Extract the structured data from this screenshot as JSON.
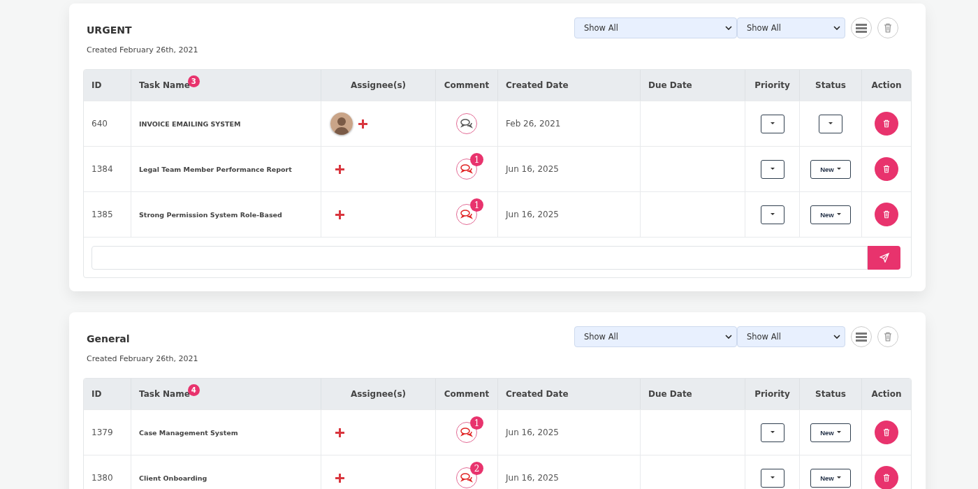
{
  "sections": [
    {
      "title": "URGENT",
      "created": "Created February 26th, 2021",
      "filters": [
        {
          "value": "Show All"
        },
        {
          "value": "Show All"
        }
      ],
      "task_count": "3",
      "columns": [
        "ID",
        "Task Name",
        "Assignee(s)",
        "Comment",
        "Created Date",
        "Due Date",
        "Priority",
        "Status",
        "Action"
      ],
      "rows": [
        {
          "id": "640",
          "task": "INVOICE EMAILING SYSTEM",
          "has_avatar": true,
          "comment_count": null,
          "created": "Feb 26, 2021",
          "status": null
        },
        {
          "id": "1384",
          "task": "Legal Team Member Performance Report",
          "has_avatar": false,
          "comment_count": "1",
          "created": "Jun 16, 2025",
          "status": "New"
        },
        {
          "id": "1385",
          "task": "Strong Permission System Role-Based",
          "has_avatar": false,
          "comment_count": "1",
          "created": "Jun 16, 2025",
          "status": "New"
        }
      ],
      "has_comment_box": true
    },
    {
      "title": "General",
      "created": "Created February 26th, 2021",
      "filters": [
        {
          "value": "Show All"
        },
        {
          "value": "Show All"
        }
      ],
      "task_count": "4",
      "columns": [
        "ID",
        "Task Name",
        "Assignee(s)",
        "Comment",
        "Created Date",
        "Due Date",
        "Priority",
        "Status",
        "Action"
      ],
      "rows": [
        {
          "id": "1379",
          "task": "Case Management System",
          "has_avatar": false,
          "comment_count": "1",
          "created": "Jun 16, 2025",
          "status": "New"
        },
        {
          "id": "1380",
          "task": "Client Onboarding",
          "has_avatar": false,
          "comment_count": "2",
          "created": "Jun 16, 2025",
          "status": "New"
        }
      ]
    }
  ]
}
